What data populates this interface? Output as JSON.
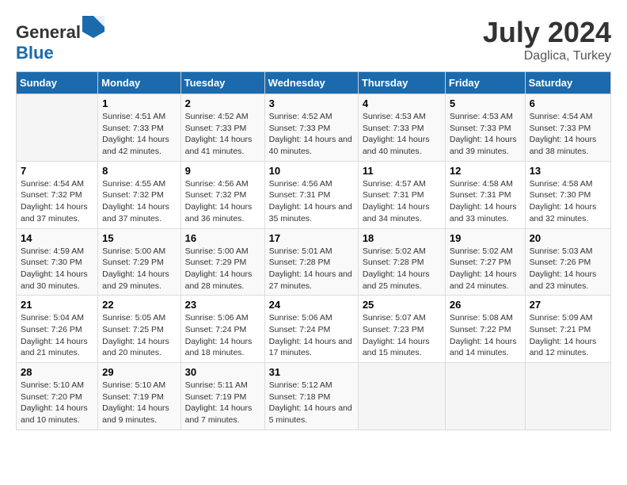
{
  "header": {
    "logo_general": "General",
    "logo_blue": "Blue",
    "title": "July 2024",
    "subtitle": "Daglica, Turkey"
  },
  "columns": [
    "Sunday",
    "Monday",
    "Tuesday",
    "Wednesday",
    "Thursday",
    "Friday",
    "Saturday"
  ],
  "weeks": [
    [
      {
        "day": "",
        "sunrise": "",
        "sunset": "",
        "daylight": ""
      },
      {
        "day": "1",
        "sunrise": "Sunrise: 4:51 AM",
        "sunset": "Sunset: 7:33 PM",
        "daylight": "Daylight: 14 hours and 42 minutes."
      },
      {
        "day": "2",
        "sunrise": "Sunrise: 4:52 AM",
        "sunset": "Sunset: 7:33 PM",
        "daylight": "Daylight: 14 hours and 41 minutes."
      },
      {
        "day": "3",
        "sunrise": "Sunrise: 4:52 AM",
        "sunset": "Sunset: 7:33 PM",
        "daylight": "Daylight: 14 hours and 40 minutes."
      },
      {
        "day": "4",
        "sunrise": "Sunrise: 4:53 AM",
        "sunset": "Sunset: 7:33 PM",
        "daylight": "Daylight: 14 hours and 40 minutes."
      },
      {
        "day": "5",
        "sunrise": "Sunrise: 4:53 AM",
        "sunset": "Sunset: 7:33 PM",
        "daylight": "Daylight: 14 hours and 39 minutes."
      },
      {
        "day": "6",
        "sunrise": "Sunrise: 4:54 AM",
        "sunset": "Sunset: 7:33 PM",
        "daylight": "Daylight: 14 hours and 38 minutes."
      }
    ],
    [
      {
        "day": "7",
        "sunrise": "Sunrise: 4:54 AM",
        "sunset": "Sunset: 7:32 PM",
        "daylight": "Daylight: 14 hours and 37 minutes."
      },
      {
        "day": "8",
        "sunrise": "Sunrise: 4:55 AM",
        "sunset": "Sunset: 7:32 PM",
        "daylight": "Daylight: 14 hours and 37 minutes."
      },
      {
        "day": "9",
        "sunrise": "Sunrise: 4:56 AM",
        "sunset": "Sunset: 7:32 PM",
        "daylight": "Daylight: 14 hours and 36 minutes."
      },
      {
        "day": "10",
        "sunrise": "Sunrise: 4:56 AM",
        "sunset": "Sunset: 7:31 PM",
        "daylight": "Daylight: 14 hours and 35 minutes."
      },
      {
        "day": "11",
        "sunrise": "Sunrise: 4:57 AM",
        "sunset": "Sunset: 7:31 PM",
        "daylight": "Daylight: 14 hours and 34 minutes."
      },
      {
        "day": "12",
        "sunrise": "Sunrise: 4:58 AM",
        "sunset": "Sunset: 7:31 PM",
        "daylight": "Daylight: 14 hours and 33 minutes."
      },
      {
        "day": "13",
        "sunrise": "Sunrise: 4:58 AM",
        "sunset": "Sunset: 7:30 PM",
        "daylight": "Daylight: 14 hours and 32 minutes."
      }
    ],
    [
      {
        "day": "14",
        "sunrise": "Sunrise: 4:59 AM",
        "sunset": "Sunset: 7:30 PM",
        "daylight": "Daylight: 14 hours and 30 minutes."
      },
      {
        "day": "15",
        "sunrise": "Sunrise: 5:00 AM",
        "sunset": "Sunset: 7:29 PM",
        "daylight": "Daylight: 14 hours and 29 minutes."
      },
      {
        "day": "16",
        "sunrise": "Sunrise: 5:00 AM",
        "sunset": "Sunset: 7:29 PM",
        "daylight": "Daylight: 14 hours and 28 minutes."
      },
      {
        "day": "17",
        "sunrise": "Sunrise: 5:01 AM",
        "sunset": "Sunset: 7:28 PM",
        "daylight": "Daylight: 14 hours and 27 minutes."
      },
      {
        "day": "18",
        "sunrise": "Sunrise: 5:02 AM",
        "sunset": "Sunset: 7:28 PM",
        "daylight": "Daylight: 14 hours and 25 minutes."
      },
      {
        "day": "19",
        "sunrise": "Sunrise: 5:02 AM",
        "sunset": "Sunset: 7:27 PM",
        "daylight": "Daylight: 14 hours and 24 minutes."
      },
      {
        "day": "20",
        "sunrise": "Sunrise: 5:03 AM",
        "sunset": "Sunset: 7:26 PM",
        "daylight": "Daylight: 14 hours and 23 minutes."
      }
    ],
    [
      {
        "day": "21",
        "sunrise": "Sunrise: 5:04 AM",
        "sunset": "Sunset: 7:26 PM",
        "daylight": "Daylight: 14 hours and 21 minutes."
      },
      {
        "day": "22",
        "sunrise": "Sunrise: 5:05 AM",
        "sunset": "Sunset: 7:25 PM",
        "daylight": "Daylight: 14 hours and 20 minutes."
      },
      {
        "day": "23",
        "sunrise": "Sunrise: 5:06 AM",
        "sunset": "Sunset: 7:24 PM",
        "daylight": "Daylight: 14 hours and 18 minutes."
      },
      {
        "day": "24",
        "sunrise": "Sunrise: 5:06 AM",
        "sunset": "Sunset: 7:24 PM",
        "daylight": "Daylight: 14 hours and 17 minutes."
      },
      {
        "day": "25",
        "sunrise": "Sunrise: 5:07 AM",
        "sunset": "Sunset: 7:23 PM",
        "daylight": "Daylight: 14 hours and 15 minutes."
      },
      {
        "day": "26",
        "sunrise": "Sunrise: 5:08 AM",
        "sunset": "Sunset: 7:22 PM",
        "daylight": "Daylight: 14 hours and 14 minutes."
      },
      {
        "day": "27",
        "sunrise": "Sunrise: 5:09 AM",
        "sunset": "Sunset: 7:21 PM",
        "daylight": "Daylight: 14 hours and 12 minutes."
      }
    ],
    [
      {
        "day": "28",
        "sunrise": "Sunrise: 5:10 AM",
        "sunset": "Sunset: 7:20 PM",
        "daylight": "Daylight: 14 hours and 10 minutes."
      },
      {
        "day": "29",
        "sunrise": "Sunrise: 5:10 AM",
        "sunset": "Sunset: 7:19 PM",
        "daylight": "Daylight: 14 hours and 9 minutes."
      },
      {
        "day": "30",
        "sunrise": "Sunrise: 5:11 AM",
        "sunset": "Sunset: 7:19 PM",
        "daylight": "Daylight: 14 hours and 7 minutes."
      },
      {
        "day": "31",
        "sunrise": "Sunrise: 5:12 AM",
        "sunset": "Sunset: 7:18 PM",
        "daylight": "Daylight: 14 hours and 5 minutes."
      },
      {
        "day": "",
        "sunrise": "",
        "sunset": "",
        "daylight": ""
      },
      {
        "day": "",
        "sunrise": "",
        "sunset": "",
        "daylight": ""
      },
      {
        "day": "",
        "sunrise": "",
        "sunset": "",
        "daylight": ""
      }
    ]
  ]
}
